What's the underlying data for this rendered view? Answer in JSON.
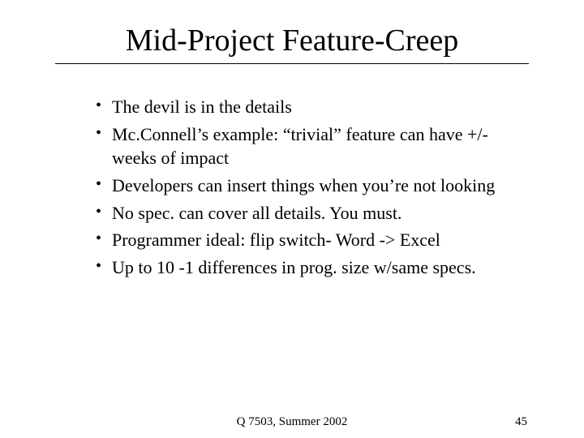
{
  "title": "Mid-Project Feature-Creep",
  "bullets": [
    "The devil is in the details",
    "Mc.Connell’s example: “trivial” feature can have +/- weeks of impact",
    "Developers can insert things when you’re not looking",
    "No spec. can cover all details. You must.",
    "Programmer ideal: flip switch- Word -> Excel",
    "Up to 10 -1 differences in prog. size w/same specs."
  ],
  "footer": {
    "center": "Q 7503, Summer 2002",
    "page": "45"
  }
}
